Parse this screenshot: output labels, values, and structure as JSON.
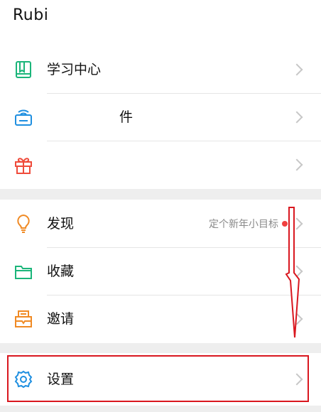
{
  "profile": {
    "name": "Rubi"
  },
  "menu_section_1": {
    "items": [
      {
        "icon": "book-icon",
        "label": "学习中心",
        "color": "#1bb57a"
      },
      {
        "icon": "wifi-box-icon",
        "label": "件",
        "color": "#1f8fe0"
      },
      {
        "icon": "gift-icon",
        "label": "",
        "color": "#ef4b3b"
      }
    ]
  },
  "menu_section_2": {
    "items": [
      {
        "icon": "lightbulb-icon",
        "label": "发现",
        "hint": "定个新年小目标",
        "color": "#f08a24"
      },
      {
        "icon": "folder-icon",
        "label": "收藏",
        "color": "#1bb57a"
      },
      {
        "icon": "invite-icon",
        "label": "邀请",
        "color": "#f08a24"
      }
    ]
  },
  "menu_section_3": {
    "items": [
      {
        "icon": "gear-icon",
        "label": "设置",
        "color": "#1f8fe0"
      }
    ]
  },
  "annotation": {
    "highlight_color": "#d9171f",
    "arrow_icon": "down-arrow-icon"
  },
  "colors": {
    "chevron": "#c7c7c7",
    "divider": "#e5e5e5",
    "background": "#eeeeee",
    "dot": "#f04040"
  }
}
